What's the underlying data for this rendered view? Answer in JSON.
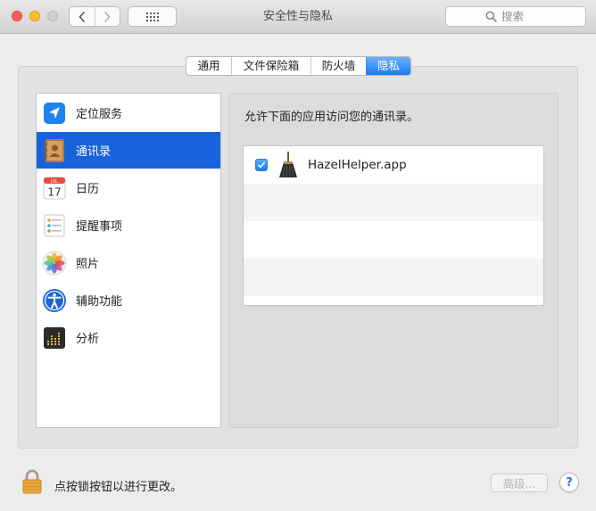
{
  "window": {
    "title": "安全性与隐私",
    "search_placeholder": "搜索"
  },
  "tabs": [
    {
      "label": "通用",
      "active": false
    },
    {
      "label": "文件保险箱",
      "active": false
    },
    {
      "label": "防火墙",
      "active": false
    },
    {
      "label": "隐私",
      "active": true
    }
  ],
  "sidebar": {
    "items": [
      {
        "label": "定位服务",
        "icon": "location-arrow-icon",
        "selected": false
      },
      {
        "label": "通讯录",
        "icon": "contacts-book-icon",
        "selected": true
      },
      {
        "label": "日历",
        "icon": "calendar-icon",
        "selected": false
      },
      {
        "label": "提醒事项",
        "icon": "reminders-icon",
        "selected": false
      },
      {
        "label": "照片",
        "icon": "photos-icon",
        "selected": false
      },
      {
        "label": "辅助功能",
        "icon": "accessibility-icon",
        "selected": false
      },
      {
        "label": "分析",
        "icon": "analytics-icon",
        "selected": false
      }
    ],
    "calendar_icon": {
      "month": "JUL",
      "day": "17"
    }
  },
  "main": {
    "description": "允许下面的应用访问您的通讯录。",
    "apps": [
      {
        "name": "HazelHelper.app",
        "checked": true,
        "icon": "hazel-broom-icon"
      }
    ]
  },
  "footer": {
    "lock_text": "点按锁按钮以进行更改。",
    "advanced_label": "高级...",
    "help_label": "?"
  },
  "colors": {
    "selection": "#1763dc",
    "tab_active": "#1b7cf2",
    "checkbox": "#1d7df2"
  }
}
